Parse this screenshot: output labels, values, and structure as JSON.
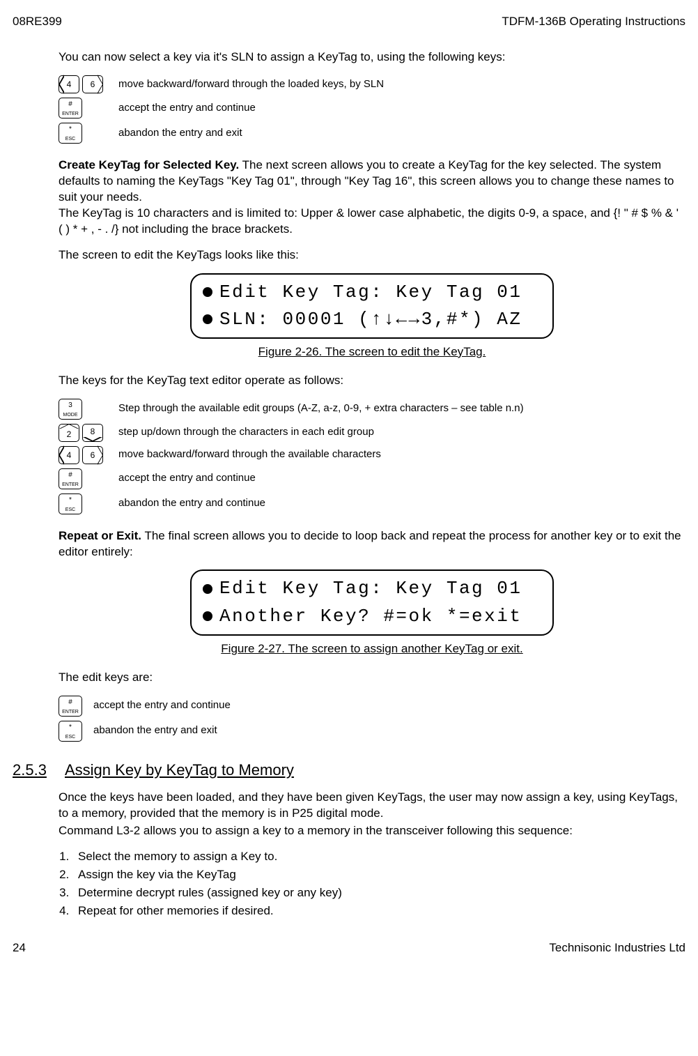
{
  "header": {
    "left": "08RE399",
    "right": "TDFM-136B Operating Instructions"
  },
  "footer": {
    "left": "24",
    "right": "Technisonic Industries Ltd"
  },
  "p1": "You can now select a key via it's SLN to assign a KeyTag to, using the following keys:",
  "kd": {
    "movebf_sln": "move backward/forward through the loaded keys, by SLN",
    "accept_cont": "accept the entry and continue",
    "abandon_exit": "abandon the entry and exit",
    "step_groups": "Step through the available edit groups (A-Z, a-z, 0-9, + extra characters – see table n.n)",
    "step_updown": "step up/down through the characters in each edit group",
    "movebf_chars": "move backward/forward through the available characters",
    "abandon_cont": "abandon the entry and continue"
  },
  "create": {
    "title": "Create KeyTag for Selected Key.",
    "body1": " The next screen allows you to create a KeyTag for the key selected.  The system defaults to naming the KeyTags \"Key Tag 01\", through \"Key Tag 16\", this screen allows you to change these names to suit your needs.",
    "body2": "The KeyTag is 10 characters and is limited to:  Upper & lower case alphabetic, the digits 0-9, a space, and {! \" # $ % & ' ( ) * + , - . /}  not including the brace brackets."
  },
  "p2": "The screen to edit the KeyTags looks like this:",
  "lcd1": {
    "l1": "Edit Key Tag: Key Tag 01",
    "l2": "SLN: 00001 (↑↓←→3,#*) AZ"
  },
  "fig1": "Figure 2-26. The screen to edit the KeyTag.",
  "p3": "The keys for the KeyTag text editor operate as follows:",
  "repeat": {
    "title": "Repeat or Exit.",
    "body": " The final screen allows you to decide to loop back and repeat the process for another key or to exit the editor entirely:"
  },
  "lcd2": {
    "l1": "Edit Key Tag: Key Tag 01",
    "l2": "Another Key? #=ok *=exit"
  },
  "fig2": "Figure 2-27. The screen to assign another KeyTag or exit.",
  "p4": "The edit keys are:",
  "section": {
    "num": "2.5.3",
    "title": "Assign Key by KeyTag to Memory"
  },
  "p5": "Once the keys have been loaded, and they have been given KeyTags, the user may now assign a key, using KeyTags, to a memory, provided that the memory is in P25 digital mode.",
  "p6": "Command L3-2 allows you to assign a key to a memory in the transceiver following this sequence:",
  "steps": [
    "Select the memory to assign a Key to.",
    "Assign the key via the KeyTag",
    "Determine decrypt rules (assigned key or any key)",
    "Repeat for other memories if desired."
  ],
  "keys": {
    "k4": "4",
    "k6": "6",
    "k2": "2",
    "k8": "8",
    "k3": "3",
    "mode": "MODE",
    "enter_top": "#",
    "enter_sub": "ENTER",
    "esc_top": "*",
    "esc_sub": "ESC"
  }
}
